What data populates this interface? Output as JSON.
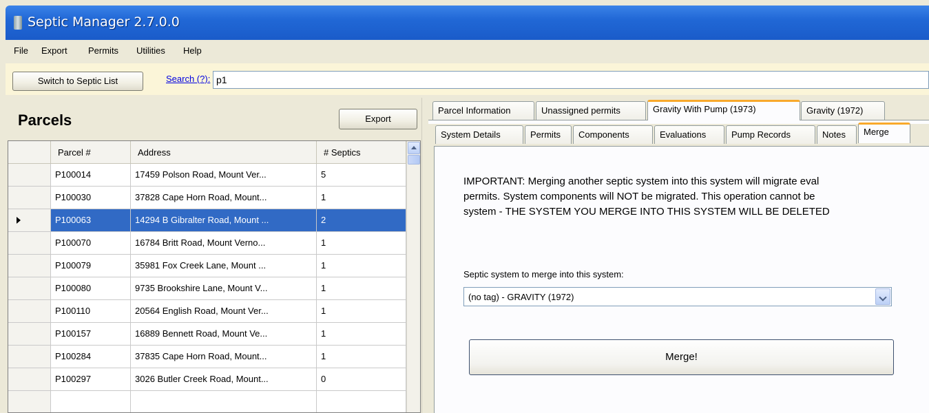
{
  "window": {
    "title": "Septic Manager 2.7.0.0"
  },
  "menu": {
    "items": [
      "File",
      "Export",
      "Permits",
      "Utilities",
      "Help"
    ]
  },
  "toolbar": {
    "switch_label": "Switch to Septic List",
    "search_link": "Search (?):",
    "search_value": "p1"
  },
  "parcels": {
    "title": "Parcels",
    "export_label": "Export",
    "columns": [
      "Parcel #",
      "Address",
      "# Septics"
    ],
    "rows": [
      {
        "parcel": "P100014",
        "address": "17459 Polson Road, Mount Ver...",
        "septics": "5"
      },
      {
        "parcel": "P100030",
        "address": "37828 Cape Horn Road, Mount...",
        "septics": "1"
      },
      {
        "parcel": "P100063",
        "address": "14294 B Gibralter Road, Mount ...",
        "septics": "2"
      },
      {
        "parcel": "P100070",
        "address": "16784 Britt Road, Mount Verno...",
        "septics": "1"
      },
      {
        "parcel": "P100079",
        "address": "35981 Fox Creek Lane, Mount ...",
        "septics": "1"
      },
      {
        "parcel": "P100080",
        "address": "9735 Brookshire Lane, Mount V...",
        "septics": "1"
      },
      {
        "parcel": "P100110",
        "address": "20564 English Road, Mount Ver...",
        "septics": "1"
      },
      {
        "parcel": "P100157",
        "address": "16889 Bennett Road, Mount Ve...",
        "septics": "1"
      },
      {
        "parcel": "P100284",
        "address": "37835 Cape Horn Road, Mount...",
        "septics": "1"
      },
      {
        "parcel": "P100297",
        "address": "3026 Butler Creek Road, Mount...",
        "septics": "0"
      }
    ],
    "selected_row": "P100063"
  },
  "tabs_top": [
    "Parcel Information",
    "Unassigned permits",
    "Gravity With Pump (1973)",
    "Gravity (1972)"
  ],
  "tabs_top_active": "Gravity With Pump (1973)",
  "tabs_sub": [
    "System Details",
    "Permits",
    "Components",
    "Evaluations",
    "Pump Records",
    "Notes",
    "Merge"
  ],
  "tabs_sub_active": "Merge",
  "merge": {
    "important_lines": [
      "IMPORTANT: Merging another septic system into this system will migrate eval",
      "permits.  System components will NOT be migrated.  This operation cannot be",
      "system - THE SYSTEM YOU MERGE INTO THIS SYSTEM WILL BE DELETED"
    ],
    "select_label": "Septic system to merge into this system:",
    "select_value": "(no tag) - GRAVITY (1972)",
    "button_label": "Merge!"
  },
  "colors": {
    "titlebar": "#2168d6",
    "selection": "#316ac5",
    "active_tab_accent": "#f9a92b",
    "link": "#0000e0"
  }
}
